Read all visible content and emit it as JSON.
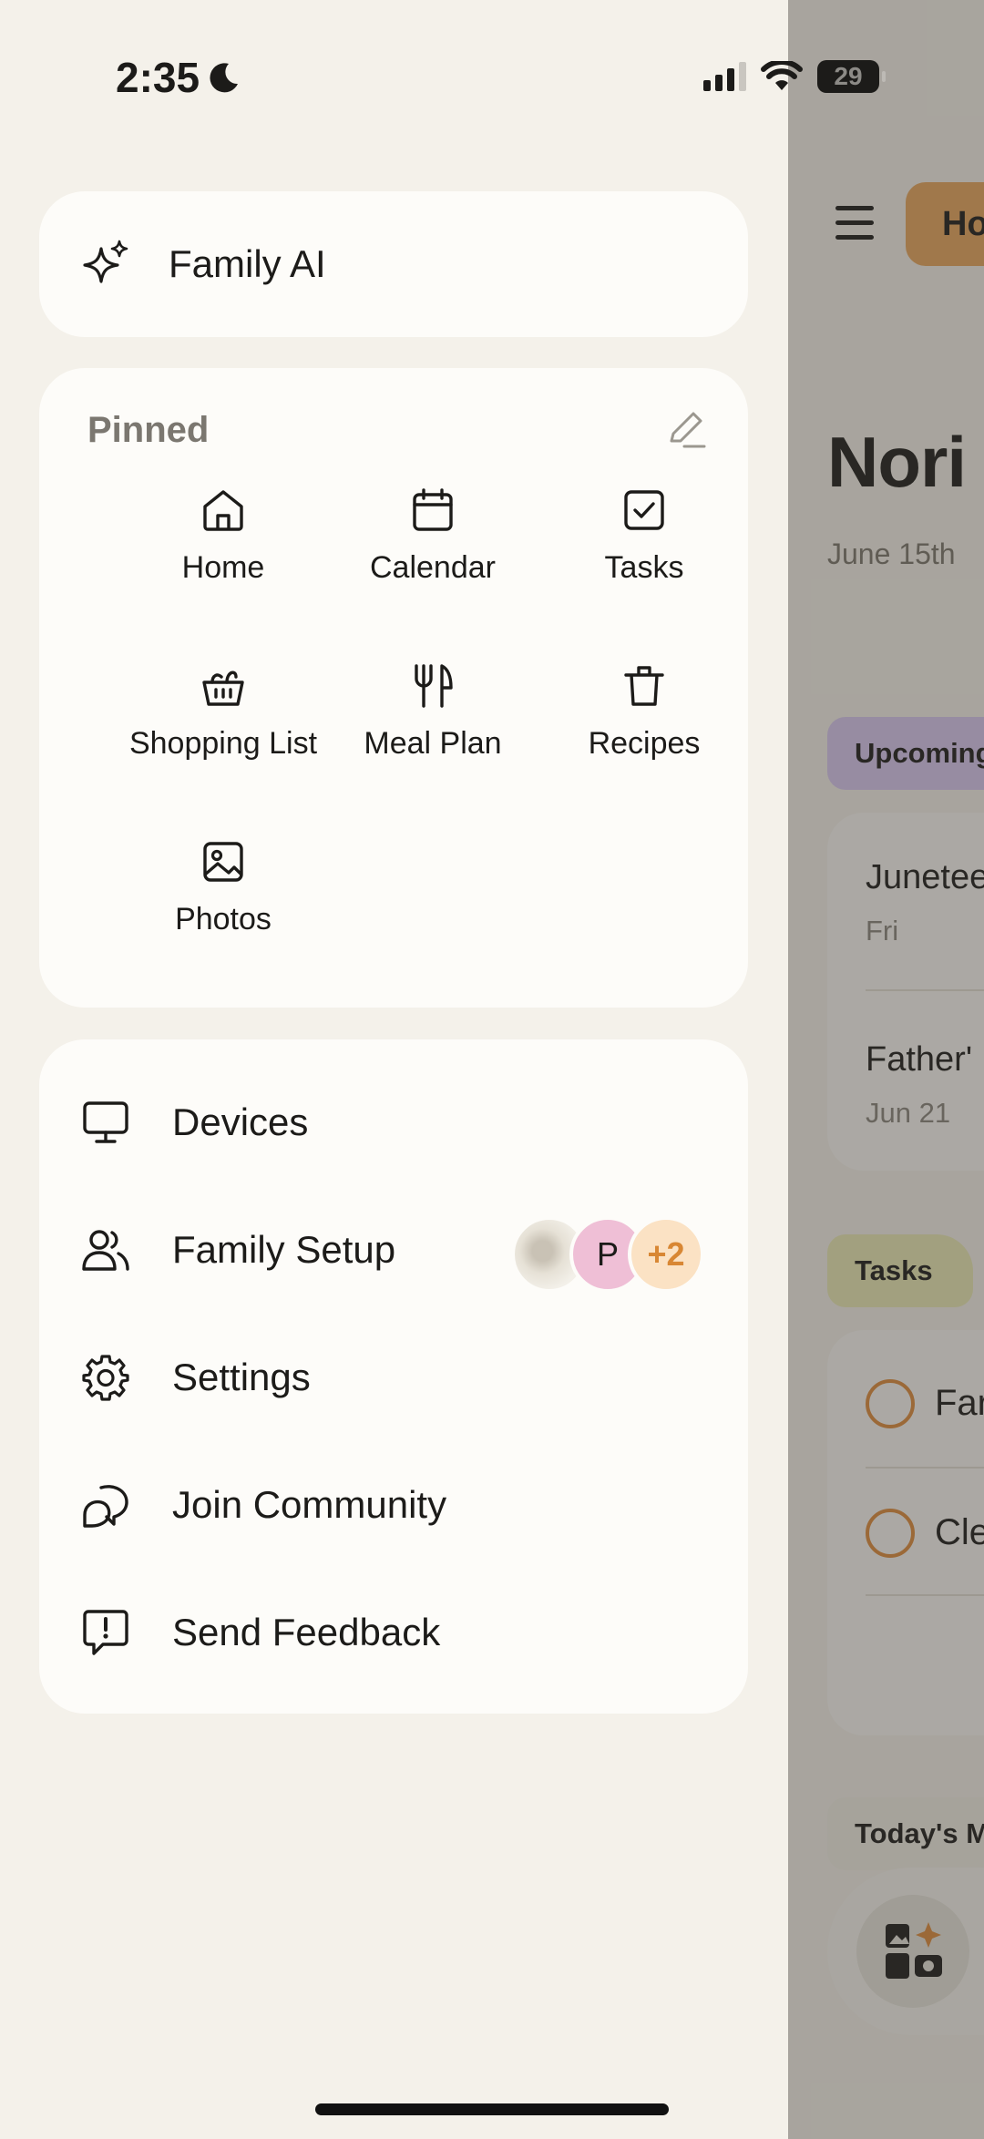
{
  "status_bar": {
    "time": "2:35",
    "battery": "29"
  },
  "drawer": {
    "ai_label": "Family AI",
    "pinned": {
      "title": "Pinned",
      "items": [
        {
          "label": "Home",
          "icon": "home-icon"
        },
        {
          "label": "Calendar",
          "icon": "calendar-icon"
        },
        {
          "label": "Tasks",
          "icon": "checkbox-icon"
        },
        {
          "label": "Shopping List",
          "icon": "basket-icon"
        },
        {
          "label": "Meal Plan",
          "icon": "utensils-icon"
        },
        {
          "label": "Recipes",
          "icon": "trash-pot-icon"
        },
        {
          "label": "Photos",
          "icon": "image-icon"
        }
      ]
    },
    "menu": [
      {
        "label": "Devices",
        "icon": "monitor-icon"
      },
      {
        "label": "Family Setup",
        "icon": "users-icon"
      },
      {
        "label": "Settings",
        "icon": "gear-icon"
      },
      {
        "label": "Join Community",
        "icon": "chat-bubbles-icon"
      },
      {
        "label": "Send Feedback",
        "icon": "feedback-icon"
      }
    ],
    "family_avatars": {
      "letter": "P",
      "more": "+2"
    }
  },
  "background_app": {
    "tab_chip": "Ho",
    "title": "Nori",
    "date": "June 15th",
    "upcoming_label": "Upcoming",
    "events": [
      {
        "title": "Junetee",
        "sub": "Fri"
      },
      {
        "title": "Father'",
        "sub": "Jun 21"
      }
    ],
    "tasks_label": "Tasks",
    "tasks": [
      "Far",
      "Cle"
    ],
    "meals_label": "Today's M"
  },
  "colors": {
    "accent_orange": "#e8a55c",
    "task_circle": "#e08c3b",
    "upcoming_chip": "#d9c8f2",
    "tasks_chip": "#ecebb6",
    "avatar_pink": "#efbfd6",
    "avatar_peach": "#fbe2c4"
  }
}
